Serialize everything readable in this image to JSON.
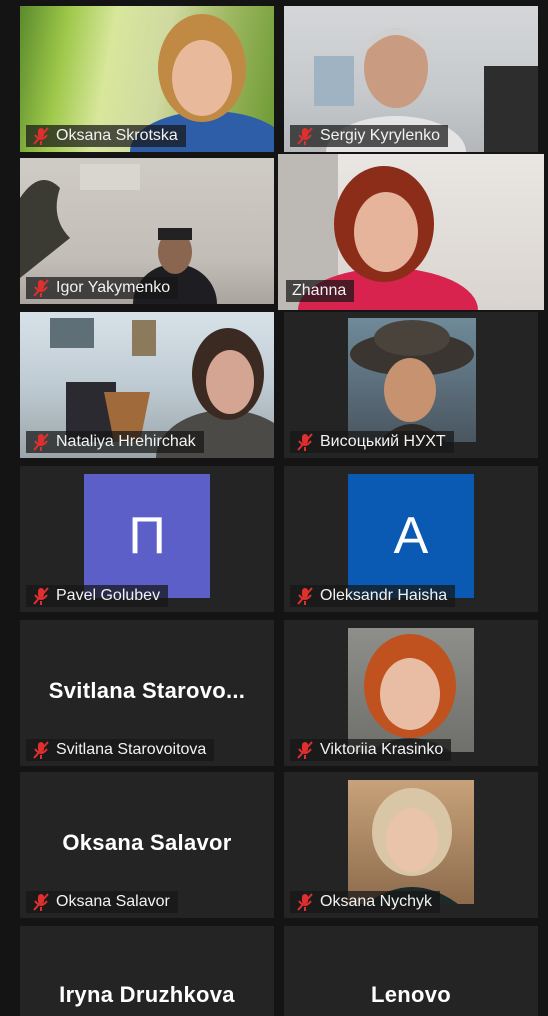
{
  "participants": [
    {
      "name": "Oksana Skrotska",
      "muted": true,
      "active": false
    },
    {
      "name": "Sergiy Kyrylenko",
      "muted": true,
      "active": false
    },
    {
      "name": "Igor Yakymenko",
      "muted": true,
      "active": false
    },
    {
      "name": "Zhanna",
      "muted": false,
      "active": true
    },
    {
      "name": "Nataliya Hrehirchak",
      "muted": true,
      "active": false
    },
    {
      "name": "Висоцький НУХТ",
      "muted": true,
      "active": false
    },
    {
      "name": "Pavel Golubev",
      "muted": true,
      "avatar_letter": "П",
      "avatar_color": "#5b5fc7"
    },
    {
      "name": "Oleksandr Haisha",
      "muted": true,
      "avatar_letter": "A",
      "avatar_color": "#0a5ab4"
    },
    {
      "name": "Svitlana Starovoitova",
      "display_name": "Svitlana  Starovo...",
      "muted": true
    },
    {
      "name": "Viktoriia Krasinko",
      "muted": true
    },
    {
      "name": "Oksana Salavor",
      "display_name": "Oksana Salavor",
      "muted": true
    },
    {
      "name": "Oksana Nychyk",
      "muted": true
    },
    {
      "display_name": "Iryna Druzhkova"
    },
    {
      "display_name": "Lenovo"
    }
  ],
  "colors": {
    "active_speaker_border": "#d9e25a",
    "muted_icon": "#e02f2f",
    "background": "#141414",
    "tile": "#242424"
  }
}
